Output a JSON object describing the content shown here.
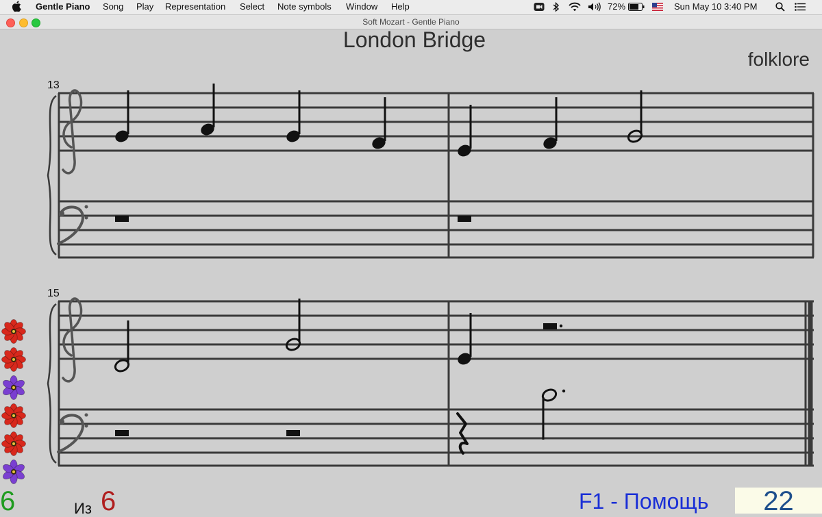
{
  "menubar": {
    "app_name": "Gentle Piano",
    "items": [
      "Song",
      "Play",
      "Representation",
      "Select",
      "Note symbols",
      "Window",
      "Help"
    ],
    "status": {
      "battery": "72%",
      "datetime": "Sun May 10  3:40 PM"
    },
    "icons": [
      "apple-icon",
      "zoom-icon",
      "bluetooth-icon",
      "wifi-icon",
      "volume-icon",
      "battery-icon",
      "us-flag-icon",
      "search-icon",
      "list-icon"
    ]
  },
  "window": {
    "title": "Soft Mozart - Gentle Piano"
  },
  "score": {
    "title": "London Bridge",
    "composer": "folklore",
    "systems": [
      {
        "measure_number": "13"
      },
      {
        "measure_number": "15"
      }
    ]
  },
  "flowers": {
    "colors": [
      "#d8281c",
      "#d8281c",
      "#7a3fd1",
      "#d8281c",
      "#d8281c",
      "#7a3fd1"
    ]
  },
  "footer": {
    "count": "6",
    "of_label": "Из",
    "total": "6",
    "help": "F1 - Помощь",
    "score_value": "22"
  },
  "colors": {
    "background": "#cfcfcf",
    "count": "#1f9b1f",
    "total": "#b01e1e",
    "help": "#1a2fd6",
    "score_box": "#fbfbe8",
    "score_value": "#1e4f8c"
  }
}
